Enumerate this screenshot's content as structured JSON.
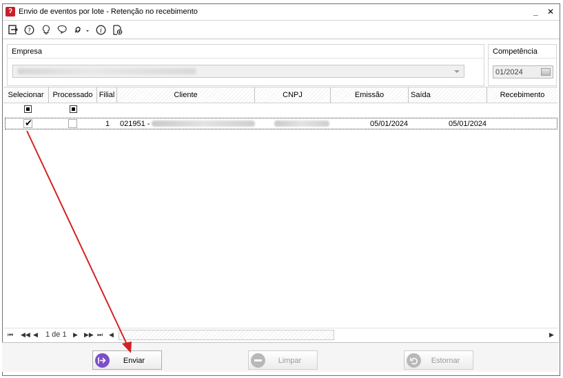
{
  "window": {
    "title": "Envio de eventos por lote - Retenção no recebimento",
    "minimize": "_",
    "close": "✕"
  },
  "toolbar": {
    "icons": [
      "exit-icon",
      "help-icon",
      "lightbulb-icon",
      "bubble-icon",
      "link-icon",
      "info-icon",
      "export-icon"
    ]
  },
  "empresa": {
    "label": "Empresa",
    "value_hidden": true
  },
  "competencia": {
    "label": "Competência",
    "value": "01/2024"
  },
  "grid": {
    "columns": [
      "Selecionar",
      "Processado",
      "Filial",
      "Cliente",
      "CNPJ",
      "Emissão",
      "Saída",
      "Recebimento"
    ],
    "rows": [
      {
        "selecionar": true,
        "processado": false,
        "filial": "1",
        "cliente_code": "021951 -",
        "emissao": "05/01/2024",
        "saida": "05/01/2024",
        "recebimento": ""
      }
    ]
  },
  "pager": {
    "page_text": "1 de 1"
  },
  "buttons": {
    "enviar": "Enviar",
    "limpar": "Limpar",
    "estornar": "Estornar"
  },
  "colors": {
    "arrow": "#d42020",
    "enviar_icon": "#7b4fc9",
    "disabled_icon": "#b8b8b8"
  }
}
